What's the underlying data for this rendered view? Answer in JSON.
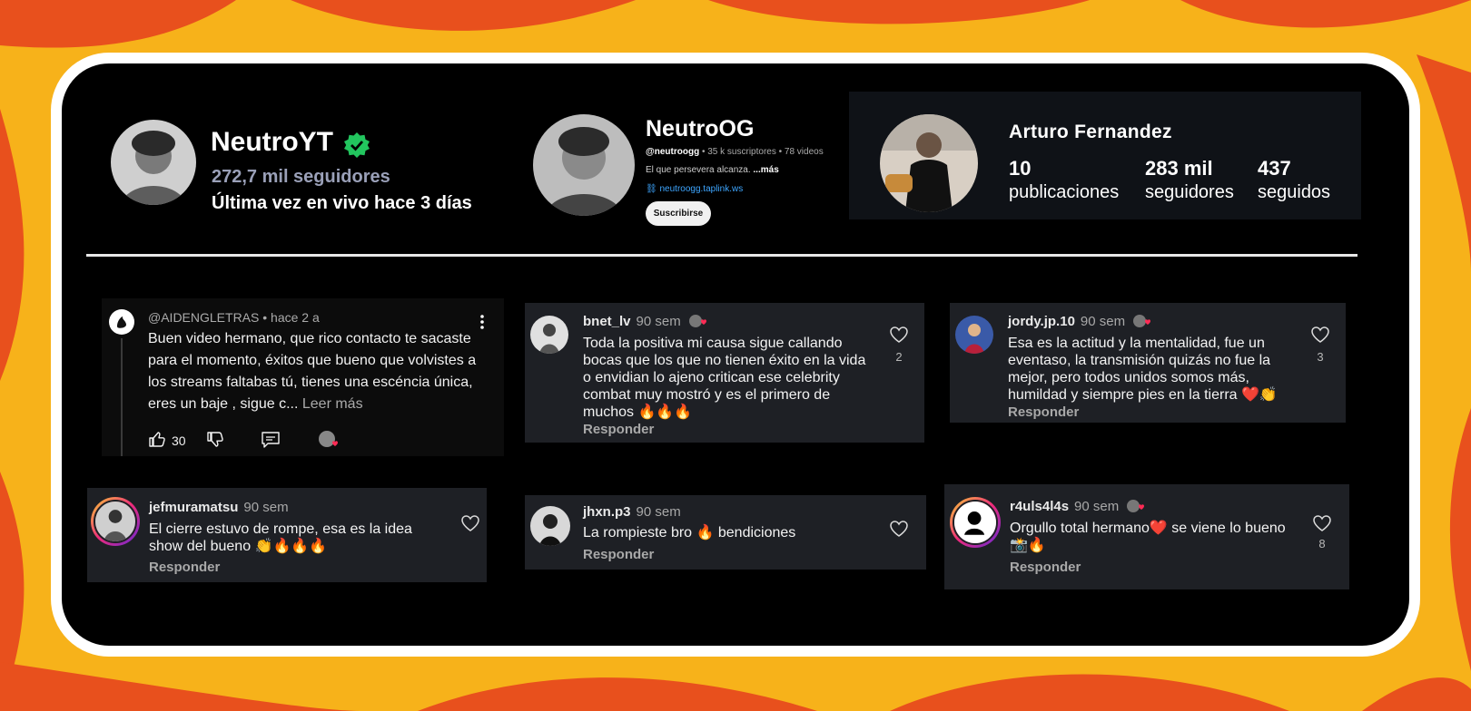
{
  "twitch": {
    "name": "NeutroYT",
    "followers": "272,7 mil seguidores",
    "last_live": "Última vez en vivo hace 3 días",
    "verified_color": "#22c55e"
  },
  "youtube": {
    "name": "NeutroOG",
    "handle": "@neutroogg",
    "meta": " • 35 k suscriptores • 78 videos",
    "description": "El que persevera alcanza. ",
    "more": "...más",
    "link": "neutroogg.taplink.ws",
    "subscribe_label": "Suscribirse"
  },
  "instagram": {
    "name": "Arturo Fernandez",
    "stats": [
      {
        "number": "10",
        "label": "publicaciones"
      },
      {
        "number": "283 mil",
        "label": "seguidores"
      },
      {
        "number": "437",
        "label": "seguidos"
      }
    ]
  },
  "youtube_comment": {
    "user": "@AIDENGLETRAS",
    "time": " • hace 2 a",
    "text": "Buen video hermano, que rico contacto te sacaste para el momento, éxitos que bueno que volvistes a los streams faltabas tú, tienes una escéncia única,  eres un baje , sigue c...",
    "more": " Leer más",
    "likes": "30"
  },
  "comments": [
    {
      "user": "bnet_lv",
      "time": "90 sem",
      "text": "Toda la positiva mi causa sigue callando bocas que los que no tienen éxito en la vida o envidian lo ajeno critican ese celebrity combat muy mostró y es el primero de muchos 🔥🔥🔥",
      "reply": "Responder",
      "likes": "2"
    },
    {
      "user": "jordy.jp.10",
      "time": "90 sem",
      "text": "Esa es la actitud y la mentalidad, fue un eventaso, la transmisión quizás no fue la mejor, pero todos unidos somos más, humildad y siempre pies en la tierra ❤️👏",
      "reply": "Responder",
      "likes": "3"
    },
    {
      "user": "jefmuramatsu",
      "time": "90 sem",
      "text": "El cierre estuvo de rompe, esa es la idea show del bueno 👏🔥🔥🔥",
      "reply": "Responder",
      "likes": ""
    },
    {
      "user": "jhxn.p3",
      "time": "90 sem",
      "text": "La rompieste bro 🔥  bendiciones",
      "reply": "Responder",
      "likes": ""
    },
    {
      "user": "r4uls4l4s",
      "time": "90 sem",
      "text": "Orgullo total hermano❤️ se viene lo bueno📸🔥",
      "reply": "Responder",
      "likes": "8"
    }
  ]
}
